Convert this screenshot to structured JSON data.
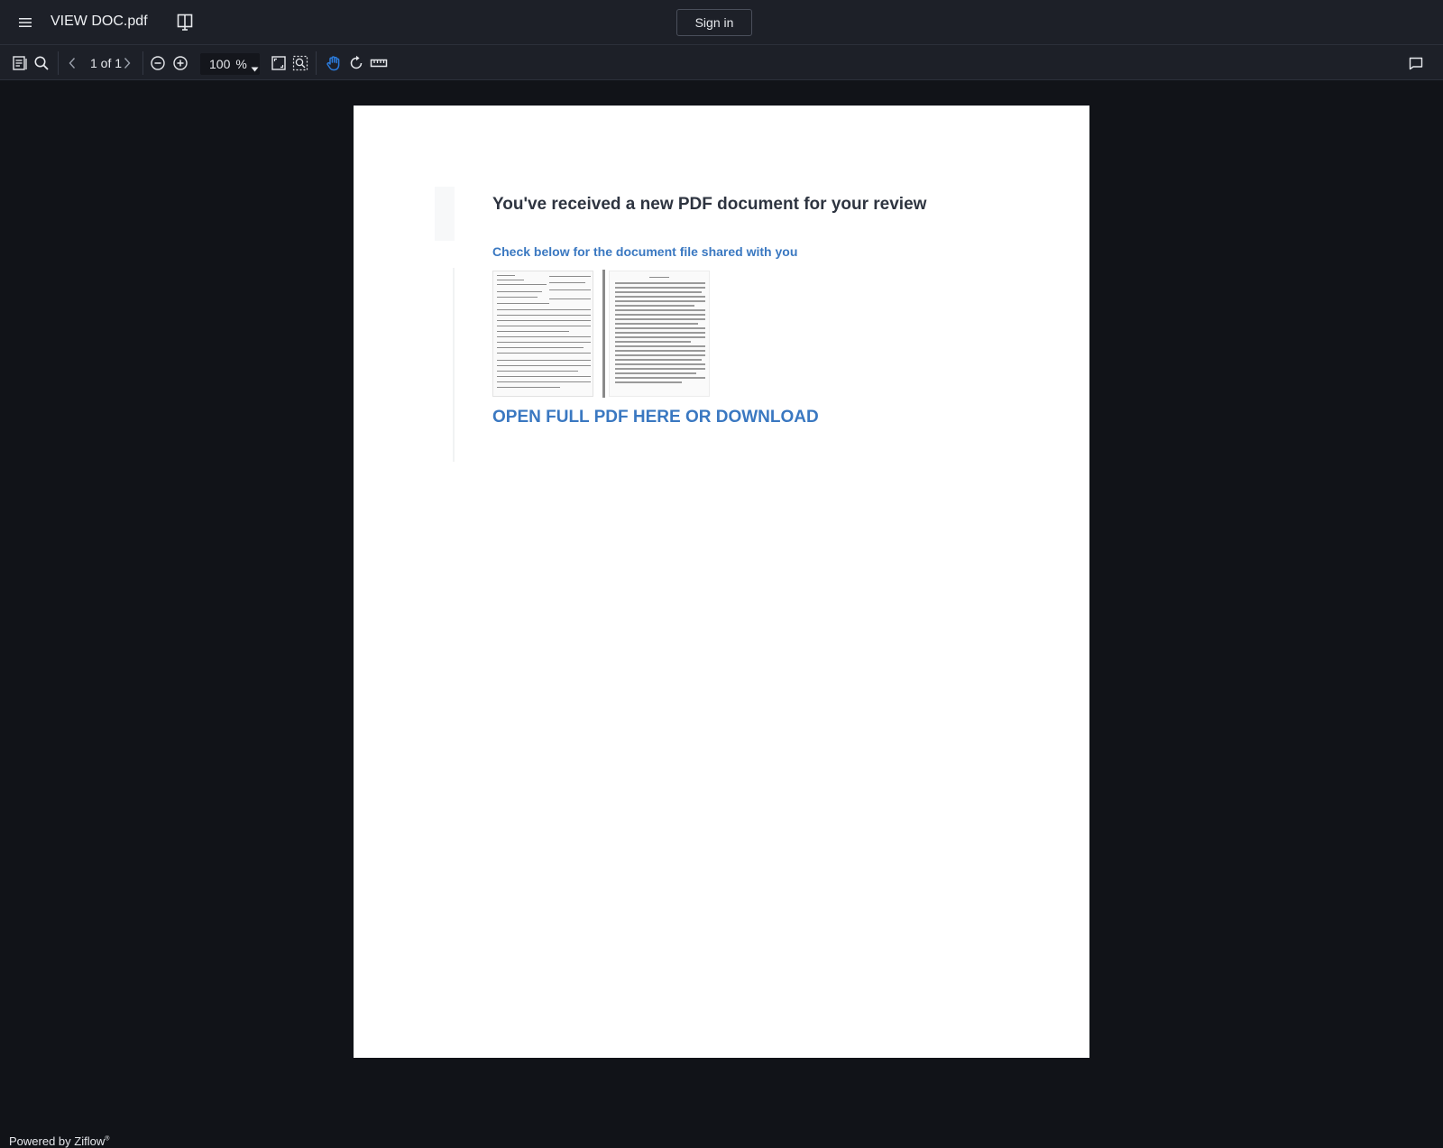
{
  "header": {
    "doc_title": "VIEW DOC.pdf",
    "signin_label": "Sign in"
  },
  "toolbar": {
    "page_indicator": "1 of 1",
    "zoom_value": "100",
    "zoom_unit": "%",
    "active_tool": "pan",
    "accent": "#2b7bdc"
  },
  "document": {
    "heading": "You've received a new PDF document for your review",
    "subheading": "Check below for the document file shared with you",
    "cta": "OPEN FULL PDF HERE OR DOWNLOAD",
    "link_color": "#3a78c1"
  },
  "footer": {
    "powered_by": "Powered by Ziflow",
    "trademark": "®"
  }
}
